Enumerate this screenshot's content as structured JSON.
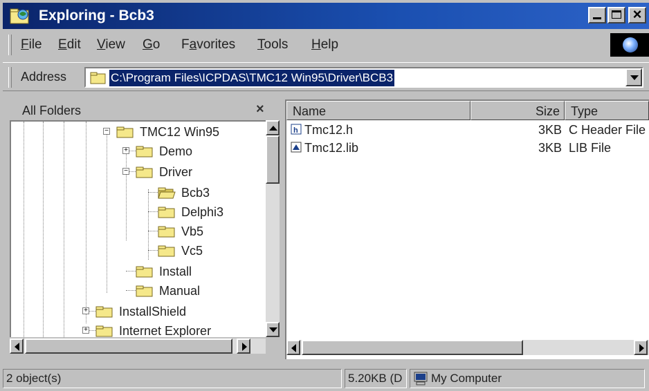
{
  "window": {
    "title": "Exploring - Bcb3"
  },
  "menu": {
    "items": [
      {
        "pre": "",
        "u": "F",
        "post": "ile"
      },
      {
        "pre": "",
        "u": "E",
        "post": "dit"
      },
      {
        "pre": "",
        "u": "V",
        "post": "iew"
      },
      {
        "pre": "",
        "u": "G",
        "post": "o"
      },
      {
        "pre": "F",
        "u": "a",
        "post": "vorites"
      },
      {
        "pre": "",
        "u": "T",
        "post": "ools"
      },
      {
        "pre": "",
        "u": "H",
        "post": "elp"
      }
    ]
  },
  "address": {
    "label": "Address",
    "value": "C:\\Program Files\\ICPDAS\\TMC12 Win95\\Driver\\BCB3"
  },
  "folders": {
    "title": "All Folders",
    "close": "×",
    "tree": [
      {
        "label": "TMC12 Win95",
        "expander": "−"
      },
      {
        "label": "Demo",
        "expander": "+"
      },
      {
        "label": "Driver",
        "expander": "−"
      },
      {
        "label": "Bcb3",
        "expander": "",
        "open": true
      },
      {
        "label": "Delphi3",
        "expander": ""
      },
      {
        "label": "Vb5",
        "expander": ""
      },
      {
        "label": "Vc5",
        "expander": ""
      },
      {
        "label": "Install",
        "expander": ""
      },
      {
        "label": "Manual",
        "expander": ""
      },
      {
        "label": "InstallShield",
        "expander": "+"
      },
      {
        "label": "Internet Explorer",
        "expander": "+"
      }
    ]
  },
  "columns": {
    "name": "Name",
    "size": "Size",
    "type": "Type"
  },
  "files": [
    {
      "name": "Tmc12.h",
      "size": "3KB",
      "type": "C Header File",
      "icon": "header-file-icon"
    },
    {
      "name": "Tmc12.lib",
      "size": "3KB",
      "type": "LIB File",
      "icon": "lib-file-icon"
    }
  ],
  "status": {
    "count": "2 object(s)",
    "size": "5.20KB (D",
    "location": "My Computer"
  },
  "colors": {
    "title_bar": "#0a246a",
    "selection": "#0a246a",
    "folder": "#f5e88a"
  }
}
